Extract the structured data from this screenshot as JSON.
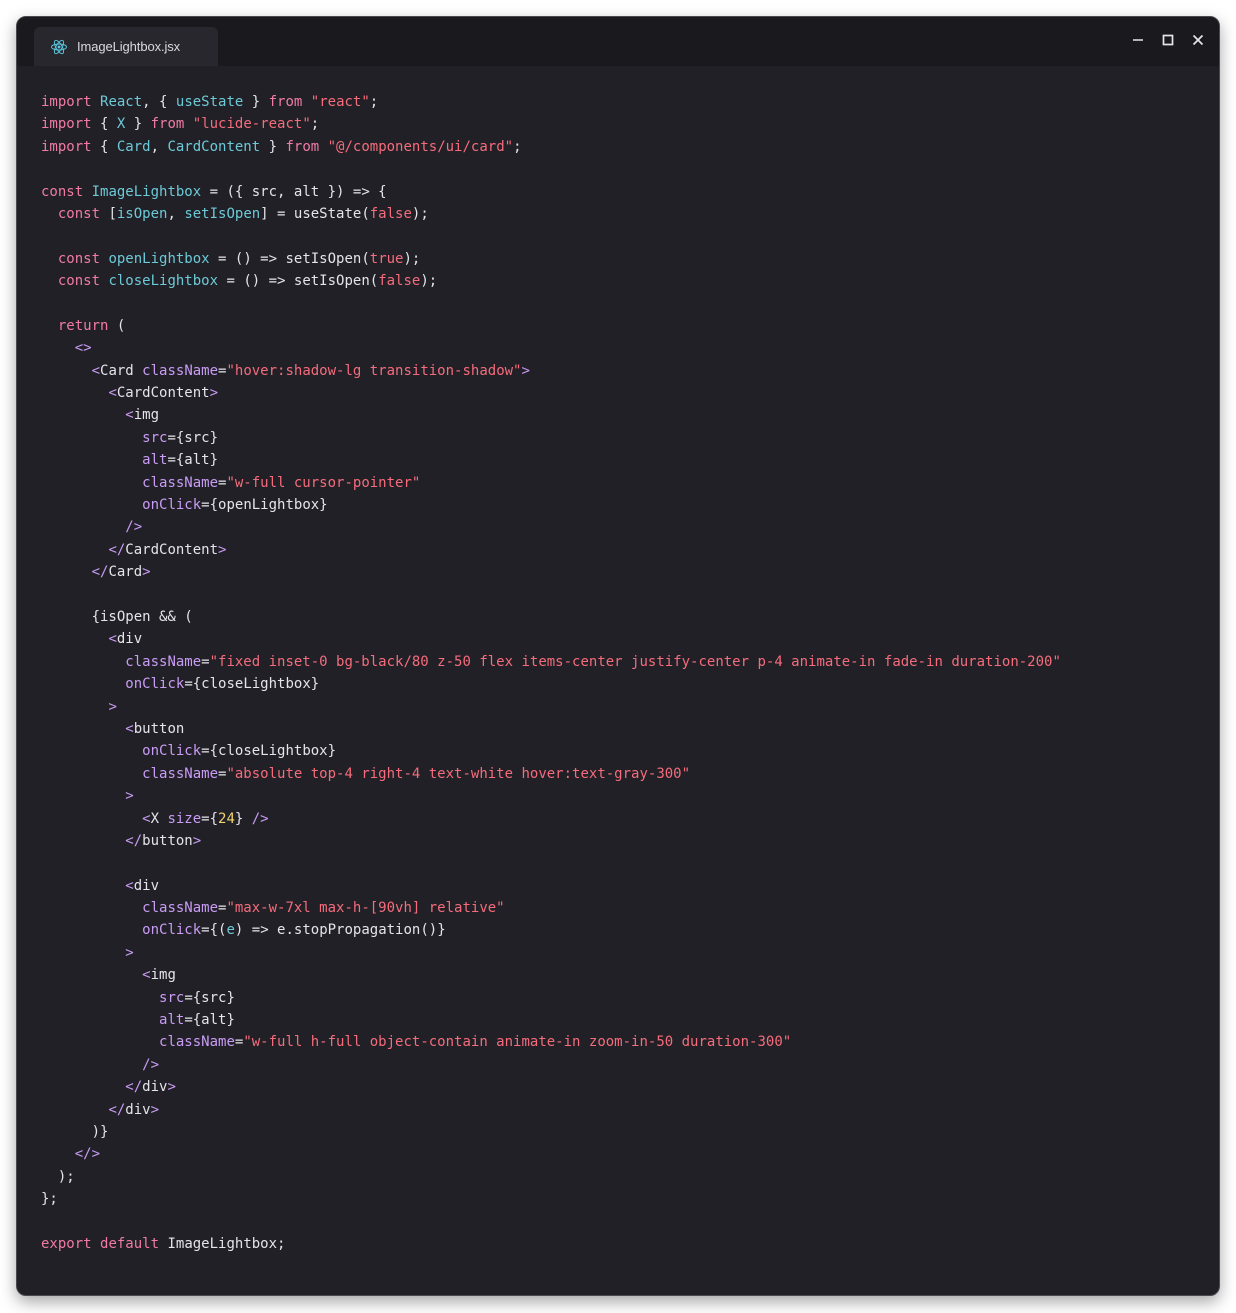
{
  "window": {
    "tab_title": "ImageLightbox.jsx",
    "tab_icon": "react-icon",
    "controls": [
      "minimize-icon",
      "maximize-icon",
      "close-icon"
    ]
  },
  "colors": {
    "background": "#212026",
    "titlebar": "#1a191e",
    "tab": "#28272d",
    "keyword": "#f17ba4",
    "identifier": "#6ccad8",
    "string": "#f56c7c",
    "jsx_tag": "#c99cf5",
    "number": "#f0d56c",
    "plain": "#e4e4ea"
  },
  "code": {
    "language": "jsx",
    "lines": [
      [
        [
          "kw",
          "import"
        ],
        [
          "p",
          " "
        ],
        [
          "id",
          "React"
        ],
        [
          "p",
          ", { "
        ],
        [
          "id",
          "useState"
        ],
        [
          "p",
          " } "
        ],
        [
          "kw",
          "from"
        ],
        [
          "p",
          " "
        ],
        [
          "str",
          "\"react\""
        ],
        [
          "p",
          ";"
        ]
      ],
      [
        [
          "kw",
          "import"
        ],
        [
          "p",
          " { "
        ],
        [
          "id",
          "X"
        ],
        [
          "p",
          " } "
        ],
        [
          "kw",
          "from"
        ],
        [
          "p",
          " "
        ],
        [
          "str",
          "\"lucide-react\""
        ],
        [
          "p",
          ";"
        ]
      ],
      [
        [
          "kw",
          "import"
        ],
        [
          "p",
          " { "
        ],
        [
          "id",
          "Card"
        ],
        [
          "p",
          ", "
        ],
        [
          "id",
          "CardContent"
        ],
        [
          "p",
          " } "
        ],
        [
          "kw",
          "from"
        ],
        [
          "p",
          " "
        ],
        [
          "str",
          "\"@/components/ui/card\""
        ],
        [
          "p",
          ";"
        ]
      ],
      [],
      [
        [
          "kw",
          "const"
        ],
        [
          "p",
          " "
        ],
        [
          "id",
          "ImageLightbox"
        ],
        [
          "p",
          " = ({ src, alt }) => {"
        ]
      ],
      [
        [
          "p",
          "  "
        ],
        [
          "kw",
          "const"
        ],
        [
          "p",
          " ["
        ],
        [
          "id",
          "isOpen"
        ],
        [
          "p",
          ", "
        ],
        [
          "id",
          "setIsOpen"
        ],
        [
          "p",
          "] = useState("
        ],
        [
          "bool",
          "false"
        ],
        [
          "p",
          ");"
        ]
      ],
      [],
      [
        [
          "p",
          "  "
        ],
        [
          "kw",
          "const"
        ],
        [
          "p",
          " "
        ],
        [
          "id",
          "openLightbox"
        ],
        [
          "p",
          " = () => setIsOpen("
        ],
        [
          "bool",
          "true"
        ],
        [
          "p",
          ");"
        ]
      ],
      [
        [
          "p",
          "  "
        ],
        [
          "kw",
          "const"
        ],
        [
          "p",
          " "
        ],
        [
          "id",
          "closeLightbox"
        ],
        [
          "p",
          " = () => setIsOpen("
        ],
        [
          "bool",
          "false"
        ],
        [
          "p",
          ");"
        ]
      ],
      [],
      [
        [
          "p",
          "  "
        ],
        [
          "kw",
          "return"
        ],
        [
          "p",
          " ("
        ]
      ],
      [
        [
          "p",
          "    "
        ],
        [
          "tag",
          "<>"
        ]
      ],
      [
        [
          "p",
          "      "
        ],
        [
          "tag",
          "<"
        ],
        [
          "p",
          "Card "
        ],
        [
          "attr",
          "className"
        ],
        [
          "p",
          "="
        ],
        [
          "str",
          "\"hover:shadow-lg transition-shadow\""
        ],
        [
          "tag",
          ">"
        ]
      ],
      [
        [
          "p",
          "        "
        ],
        [
          "tag",
          "<"
        ],
        [
          "p",
          "CardContent"
        ],
        [
          "tag",
          ">"
        ]
      ],
      [
        [
          "p",
          "          "
        ],
        [
          "tag",
          "<"
        ],
        [
          "p",
          "img"
        ]
      ],
      [
        [
          "p",
          "            "
        ],
        [
          "attr",
          "src"
        ],
        [
          "p",
          "={src}"
        ]
      ],
      [
        [
          "p",
          "            "
        ],
        [
          "attr",
          "alt"
        ],
        [
          "p",
          "={alt}"
        ]
      ],
      [
        [
          "p",
          "            "
        ],
        [
          "attr",
          "className"
        ],
        [
          "p",
          "="
        ],
        [
          "str",
          "\"w-full cursor-pointer\""
        ]
      ],
      [
        [
          "p",
          "            "
        ],
        [
          "attr",
          "onClick"
        ],
        [
          "p",
          "={openLightbox}"
        ]
      ],
      [
        [
          "p",
          "          "
        ],
        [
          "tag",
          "/>"
        ]
      ],
      [
        [
          "p",
          "        "
        ],
        [
          "tag",
          "</"
        ],
        [
          "p",
          "CardContent"
        ],
        [
          "tag",
          ">"
        ]
      ],
      [
        [
          "p",
          "      "
        ],
        [
          "tag",
          "</"
        ],
        [
          "p",
          "Card"
        ],
        [
          "tag",
          ">"
        ]
      ],
      [],
      [
        [
          "p",
          "      {isOpen && ("
        ]
      ],
      [
        [
          "p",
          "        "
        ],
        [
          "tag",
          "<"
        ],
        [
          "p",
          "div"
        ]
      ],
      [
        [
          "p",
          "          "
        ],
        [
          "attr",
          "className"
        ],
        [
          "p",
          "="
        ],
        [
          "str",
          "\"fixed inset-0 bg-black/80 z-50 flex items-center justify-center p-4 animate-in fade-in duration-200\""
        ]
      ],
      [
        [
          "p",
          "          "
        ],
        [
          "attr",
          "onClick"
        ],
        [
          "p",
          "={closeLightbox}"
        ]
      ],
      [
        [
          "p",
          "        "
        ],
        [
          "tag",
          ">"
        ]
      ],
      [
        [
          "p",
          "          "
        ],
        [
          "tag",
          "<"
        ],
        [
          "p",
          "button"
        ]
      ],
      [
        [
          "p",
          "            "
        ],
        [
          "attr",
          "onClick"
        ],
        [
          "p",
          "={closeLightbox}"
        ]
      ],
      [
        [
          "p",
          "            "
        ],
        [
          "attr",
          "className"
        ],
        [
          "p",
          "="
        ],
        [
          "str",
          "\"absolute top-4 right-4 text-white hover:text-gray-300\""
        ]
      ],
      [
        [
          "p",
          "          "
        ],
        [
          "tag",
          ">"
        ]
      ],
      [
        [
          "p",
          "            "
        ],
        [
          "tag",
          "<"
        ],
        [
          "p",
          "X "
        ],
        [
          "attr",
          "size"
        ],
        [
          "p",
          "={"
        ],
        [
          "num",
          "24"
        ],
        [
          "p",
          "} "
        ],
        [
          "tag",
          "/>"
        ]
      ],
      [
        [
          "p",
          "          "
        ],
        [
          "tag",
          "</"
        ],
        [
          "p",
          "button"
        ],
        [
          "tag",
          ">"
        ]
      ],
      [],
      [
        [
          "p",
          "          "
        ],
        [
          "tag",
          "<"
        ],
        [
          "p",
          "div"
        ]
      ],
      [
        [
          "p",
          "            "
        ],
        [
          "attr",
          "className"
        ],
        [
          "p",
          "="
        ],
        [
          "str",
          "\"max-w-7xl max-h-[90vh] relative\""
        ]
      ],
      [
        [
          "p",
          "            "
        ],
        [
          "attr",
          "onClick"
        ],
        [
          "p",
          "={("
        ],
        [
          "id",
          "e"
        ],
        [
          "p",
          ") => e.stopPropagation()}"
        ]
      ],
      [
        [
          "p",
          "          "
        ],
        [
          "tag",
          ">"
        ]
      ],
      [
        [
          "p",
          "            "
        ],
        [
          "tag",
          "<"
        ],
        [
          "p",
          "img"
        ]
      ],
      [
        [
          "p",
          "              "
        ],
        [
          "attr",
          "src"
        ],
        [
          "p",
          "={src}"
        ]
      ],
      [
        [
          "p",
          "              "
        ],
        [
          "attr",
          "alt"
        ],
        [
          "p",
          "={alt}"
        ]
      ],
      [
        [
          "p",
          "              "
        ],
        [
          "attr",
          "className"
        ],
        [
          "p",
          "="
        ],
        [
          "str",
          "\"w-full h-full object-contain animate-in zoom-in-50 duration-300\""
        ]
      ],
      [
        [
          "p",
          "            "
        ],
        [
          "tag",
          "/>"
        ]
      ],
      [
        [
          "p",
          "          "
        ],
        [
          "tag",
          "</"
        ],
        [
          "p",
          "div"
        ],
        [
          "tag",
          ">"
        ]
      ],
      [
        [
          "p",
          "        "
        ],
        [
          "tag",
          "</"
        ],
        [
          "p",
          "div"
        ],
        [
          "tag",
          ">"
        ]
      ],
      [
        [
          "p",
          "      )}"
        ]
      ],
      [
        [
          "p",
          "    "
        ],
        [
          "tag",
          "</>"
        ]
      ],
      [
        [
          "p",
          "  );"
        ]
      ],
      [
        [
          "p",
          "};"
        ]
      ],
      [],
      [
        [
          "kw",
          "export"
        ],
        [
          "p",
          " "
        ],
        [
          "kw",
          "default"
        ],
        [
          "p",
          " ImageLightbox;"
        ]
      ]
    ]
  }
}
